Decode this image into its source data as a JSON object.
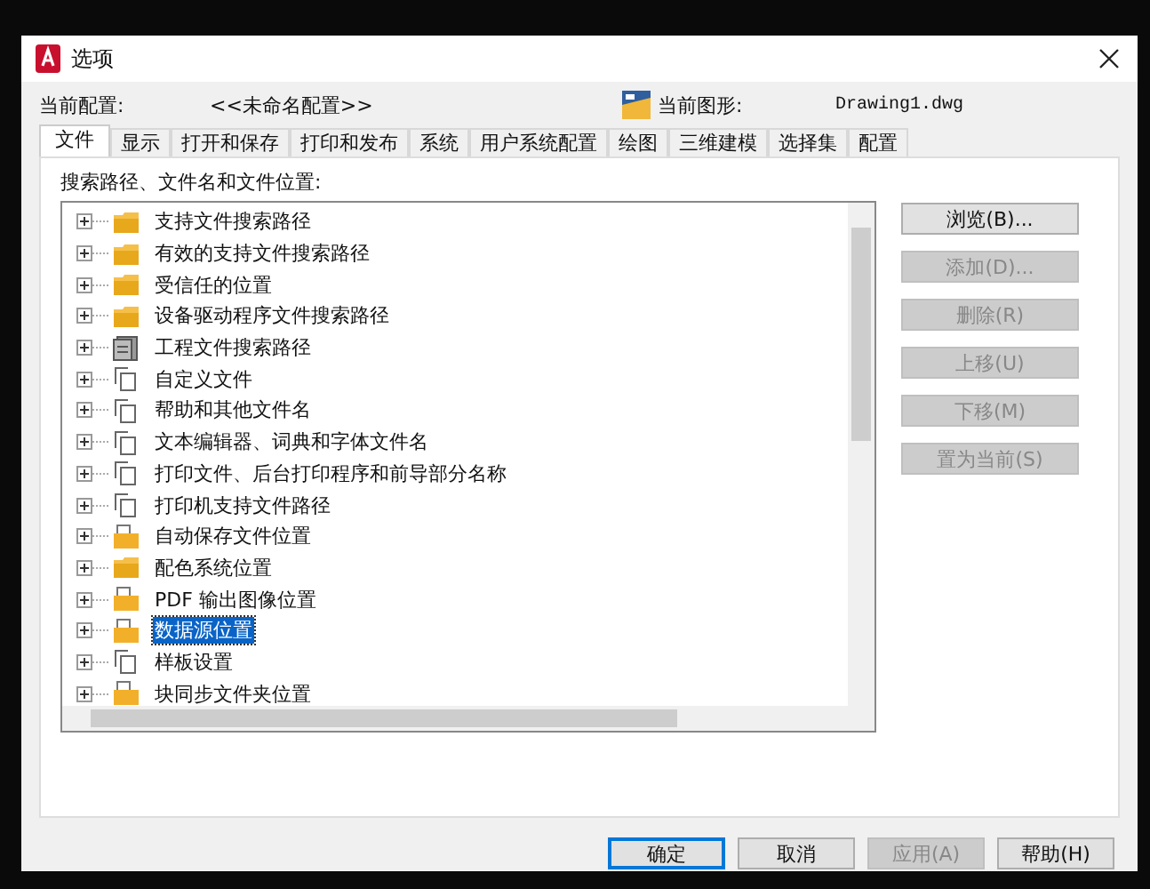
{
  "window": {
    "title": "选项"
  },
  "profile": {
    "label": "当前配置:",
    "value": "<<未命名配置>>",
    "drawing_label": "当前图形:",
    "drawing_value": "Drawing1.dwg"
  },
  "tabs": [
    {
      "label": "文件",
      "selected": true
    },
    {
      "label": "显示",
      "selected": false
    },
    {
      "label": "打开和保存",
      "selected": false
    },
    {
      "label": "打印和发布",
      "selected": false
    },
    {
      "label": "系统",
      "selected": false
    },
    {
      "label": "用户系统配置",
      "selected": false
    },
    {
      "label": "绘图",
      "selected": false
    },
    {
      "label": "三维建模",
      "selected": false
    },
    {
      "label": "选择集",
      "selected": false
    },
    {
      "label": "配置",
      "selected": false
    }
  ],
  "tree": {
    "label": "搜索路径、文件名和文件位置:",
    "items": [
      {
        "label": "支持文件搜索路径",
        "kind": "folder",
        "selected": false
      },
      {
        "label": "有效的支持文件搜索路径",
        "kind": "folder",
        "selected": false
      },
      {
        "label": "受信任的位置",
        "kind": "folder",
        "selected": false
      },
      {
        "label": "设备驱动程序文件搜索路径",
        "kind": "folder",
        "selected": false
      },
      {
        "label": "工程文件搜索路径",
        "kind": "project",
        "selected": false
      },
      {
        "label": "自定义文件",
        "kind": "file",
        "selected": false
      },
      {
        "label": "帮助和其他文件名",
        "kind": "file",
        "selected": false
      },
      {
        "label": "文本编辑器、词典和字体文件名",
        "kind": "file",
        "selected": false
      },
      {
        "label": "打印文件、后台打印程序和前导部分名称",
        "kind": "file",
        "selected": false
      },
      {
        "label": "打印机支持文件路径",
        "kind": "file",
        "selected": false
      },
      {
        "label": "自动保存文件位置",
        "kind": "docfolder",
        "selected": false
      },
      {
        "label": "配色系统位置",
        "kind": "folder",
        "selected": false
      },
      {
        "label": "PDF 输出图像位置",
        "kind": "docfolder",
        "selected": false
      },
      {
        "label": "数据源位置",
        "kind": "docfolder",
        "selected": true
      },
      {
        "label": "样板设置",
        "kind": "file",
        "selected": false
      },
      {
        "label": "块同步文件夹位置",
        "kind": "docfolder",
        "selected": false
      }
    ]
  },
  "side_buttons": [
    {
      "label": "浏览(B)...",
      "disabled": false
    },
    {
      "label": "添加(D)...",
      "disabled": true
    },
    {
      "label": "删除(R)",
      "disabled": true
    },
    {
      "label": "上移(U)",
      "disabled": true
    },
    {
      "label": "下移(M)",
      "disabled": true
    },
    {
      "label": "置为当前(S)",
      "disabled": true
    }
  ],
  "footer_buttons": [
    {
      "label": "确定",
      "disabled": false,
      "default": true
    },
    {
      "label": "取消",
      "disabled": false,
      "default": false
    },
    {
      "label": "应用(A)",
      "disabled": true,
      "default": false
    },
    {
      "label": "帮助(H)",
      "disabled": false,
      "default": false
    }
  ]
}
